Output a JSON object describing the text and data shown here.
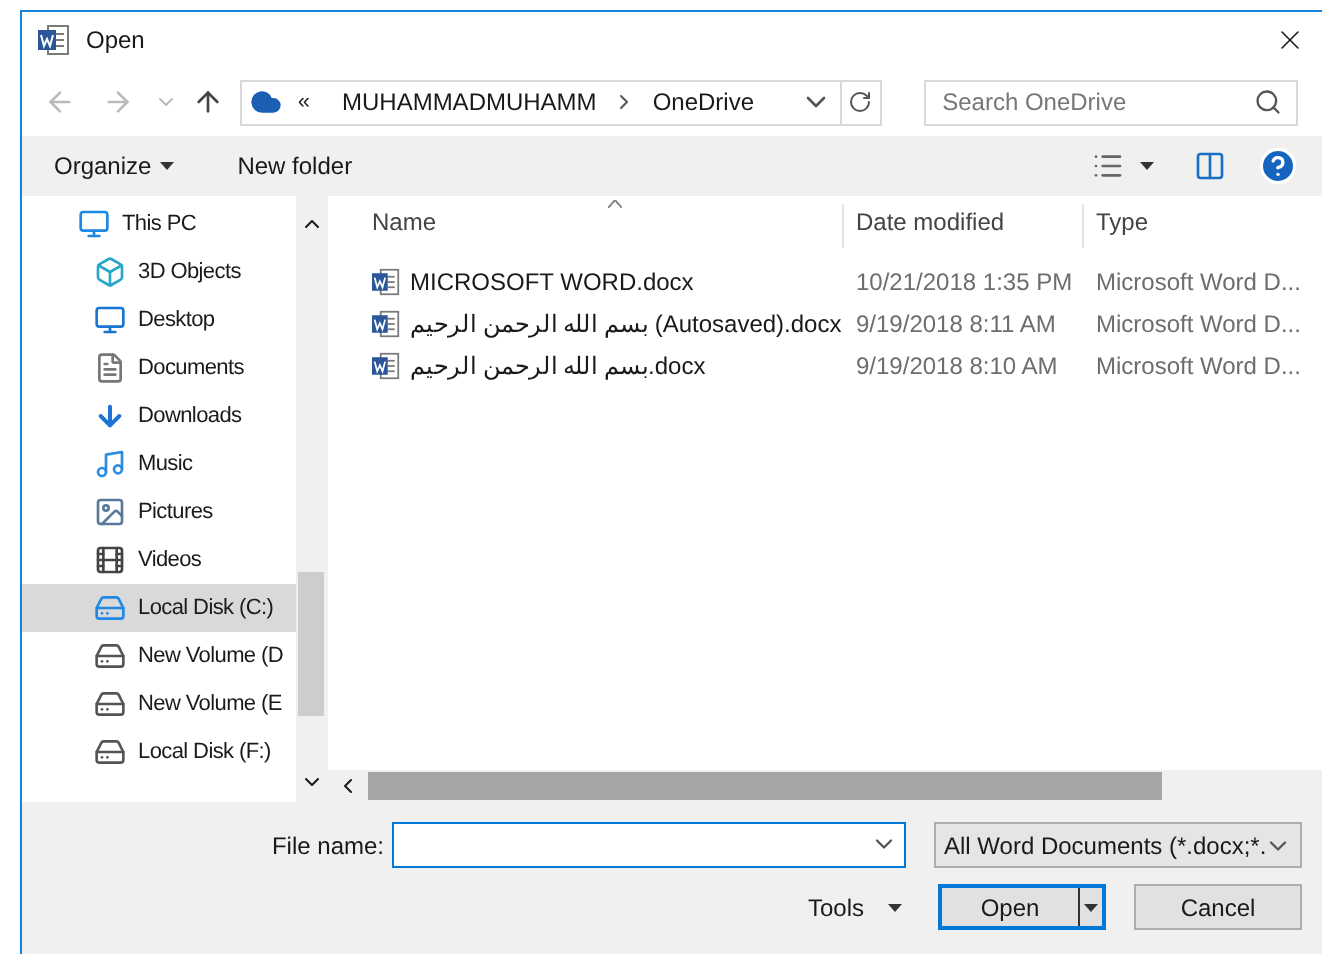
{
  "window": {
    "title": "Open"
  },
  "address": {
    "overflow": "«",
    "path": [
      {
        "label": "MUHAMMADMUHAMM"
      },
      {
        "label": "OneDrive"
      }
    ]
  },
  "search": {
    "placeholder": "Search OneDrive"
  },
  "toolbar": {
    "organize": "Organize",
    "new_folder": "New folder"
  },
  "sidebar": {
    "items": [
      {
        "label": "This PC",
        "kind": "pc",
        "selected": false
      },
      {
        "label": "3D Objects",
        "kind": "cube",
        "selected": false
      },
      {
        "label": "Desktop",
        "kind": "desktop",
        "selected": false
      },
      {
        "label": "Documents",
        "kind": "document",
        "selected": false
      },
      {
        "label": "Downloads",
        "kind": "download",
        "selected": false
      },
      {
        "label": "Music",
        "kind": "music",
        "selected": false
      },
      {
        "label": "Pictures",
        "kind": "pictures",
        "selected": false
      },
      {
        "label": "Videos",
        "kind": "video",
        "selected": false
      },
      {
        "label": "Local Disk (C:)",
        "kind": "system-drive",
        "selected": true
      },
      {
        "label": "New Volume (D",
        "kind": "drive",
        "selected": false
      },
      {
        "label": "New Volume (E",
        "kind": "drive",
        "selected": false
      },
      {
        "label": "Local Disk (F:)",
        "kind": "drive",
        "selected": false
      }
    ]
  },
  "table": {
    "columns": [
      "Name",
      "Date modified",
      "Type"
    ],
    "rows": [
      {
        "name": "MICROSOFT WORD.docx",
        "date": "10/21/2018 1:35 PM",
        "type": "Microsoft Word D..."
      },
      {
        "name": "بسم الله الرحمن الرحيم (Autosaved).docx",
        "date": "9/19/2018 8:11 AM",
        "type": "Microsoft Word D..."
      },
      {
        "name": "بسم الله الرحمن الرحيم.docx",
        "date": "9/19/2018 8:10 AM",
        "type": "Microsoft Word D..."
      }
    ]
  },
  "footer": {
    "file_name_label": "File name:",
    "file_type": "All Word Documents (*.docx;*.",
    "tools": "Tools",
    "open": "Open",
    "cancel": "Cancel"
  }
}
